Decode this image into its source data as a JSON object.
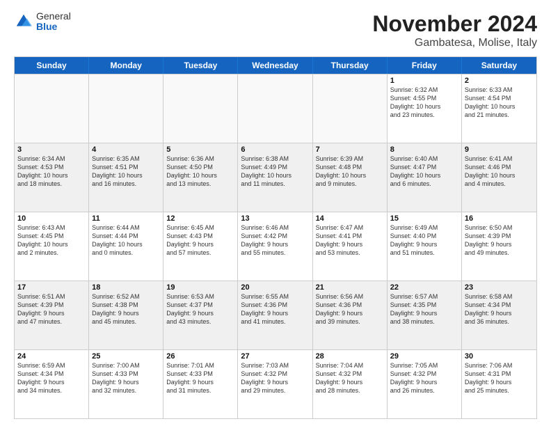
{
  "logo": {
    "general": "General",
    "blue": "Blue"
  },
  "title": "November 2024",
  "subtitle": "Gambatesa, Molise, Italy",
  "days": [
    "Sunday",
    "Monday",
    "Tuesday",
    "Wednesday",
    "Thursday",
    "Friday",
    "Saturday"
  ],
  "rows": [
    [
      {
        "day": "",
        "info": ""
      },
      {
        "day": "",
        "info": ""
      },
      {
        "day": "",
        "info": ""
      },
      {
        "day": "",
        "info": ""
      },
      {
        "day": "",
        "info": ""
      },
      {
        "day": "1",
        "info": "Sunrise: 6:32 AM\nSunset: 4:55 PM\nDaylight: 10 hours\nand 23 minutes."
      },
      {
        "day": "2",
        "info": "Sunrise: 6:33 AM\nSunset: 4:54 PM\nDaylight: 10 hours\nand 21 minutes."
      }
    ],
    [
      {
        "day": "3",
        "info": "Sunrise: 6:34 AM\nSunset: 4:53 PM\nDaylight: 10 hours\nand 18 minutes."
      },
      {
        "day": "4",
        "info": "Sunrise: 6:35 AM\nSunset: 4:51 PM\nDaylight: 10 hours\nand 16 minutes."
      },
      {
        "day": "5",
        "info": "Sunrise: 6:36 AM\nSunset: 4:50 PM\nDaylight: 10 hours\nand 13 minutes."
      },
      {
        "day": "6",
        "info": "Sunrise: 6:38 AM\nSunset: 4:49 PM\nDaylight: 10 hours\nand 11 minutes."
      },
      {
        "day": "7",
        "info": "Sunrise: 6:39 AM\nSunset: 4:48 PM\nDaylight: 10 hours\nand 9 minutes."
      },
      {
        "day": "8",
        "info": "Sunrise: 6:40 AM\nSunset: 4:47 PM\nDaylight: 10 hours\nand 6 minutes."
      },
      {
        "day": "9",
        "info": "Sunrise: 6:41 AM\nSunset: 4:46 PM\nDaylight: 10 hours\nand 4 minutes."
      }
    ],
    [
      {
        "day": "10",
        "info": "Sunrise: 6:43 AM\nSunset: 4:45 PM\nDaylight: 10 hours\nand 2 minutes."
      },
      {
        "day": "11",
        "info": "Sunrise: 6:44 AM\nSunset: 4:44 PM\nDaylight: 10 hours\nand 0 minutes."
      },
      {
        "day": "12",
        "info": "Sunrise: 6:45 AM\nSunset: 4:43 PM\nDaylight: 9 hours\nand 57 minutes."
      },
      {
        "day": "13",
        "info": "Sunrise: 6:46 AM\nSunset: 4:42 PM\nDaylight: 9 hours\nand 55 minutes."
      },
      {
        "day": "14",
        "info": "Sunrise: 6:47 AM\nSunset: 4:41 PM\nDaylight: 9 hours\nand 53 minutes."
      },
      {
        "day": "15",
        "info": "Sunrise: 6:49 AM\nSunset: 4:40 PM\nDaylight: 9 hours\nand 51 minutes."
      },
      {
        "day": "16",
        "info": "Sunrise: 6:50 AM\nSunset: 4:39 PM\nDaylight: 9 hours\nand 49 minutes."
      }
    ],
    [
      {
        "day": "17",
        "info": "Sunrise: 6:51 AM\nSunset: 4:39 PM\nDaylight: 9 hours\nand 47 minutes."
      },
      {
        "day": "18",
        "info": "Sunrise: 6:52 AM\nSunset: 4:38 PM\nDaylight: 9 hours\nand 45 minutes."
      },
      {
        "day": "19",
        "info": "Sunrise: 6:53 AM\nSunset: 4:37 PM\nDaylight: 9 hours\nand 43 minutes."
      },
      {
        "day": "20",
        "info": "Sunrise: 6:55 AM\nSunset: 4:36 PM\nDaylight: 9 hours\nand 41 minutes."
      },
      {
        "day": "21",
        "info": "Sunrise: 6:56 AM\nSunset: 4:36 PM\nDaylight: 9 hours\nand 39 minutes."
      },
      {
        "day": "22",
        "info": "Sunrise: 6:57 AM\nSunset: 4:35 PM\nDaylight: 9 hours\nand 38 minutes."
      },
      {
        "day": "23",
        "info": "Sunrise: 6:58 AM\nSunset: 4:34 PM\nDaylight: 9 hours\nand 36 minutes."
      }
    ],
    [
      {
        "day": "24",
        "info": "Sunrise: 6:59 AM\nSunset: 4:34 PM\nDaylight: 9 hours\nand 34 minutes."
      },
      {
        "day": "25",
        "info": "Sunrise: 7:00 AM\nSunset: 4:33 PM\nDaylight: 9 hours\nand 32 minutes."
      },
      {
        "day": "26",
        "info": "Sunrise: 7:01 AM\nSunset: 4:33 PM\nDaylight: 9 hours\nand 31 minutes."
      },
      {
        "day": "27",
        "info": "Sunrise: 7:03 AM\nSunset: 4:32 PM\nDaylight: 9 hours\nand 29 minutes."
      },
      {
        "day": "28",
        "info": "Sunrise: 7:04 AM\nSunset: 4:32 PM\nDaylight: 9 hours\nand 28 minutes."
      },
      {
        "day": "29",
        "info": "Sunrise: 7:05 AM\nSunset: 4:32 PM\nDaylight: 9 hours\nand 26 minutes."
      },
      {
        "day": "30",
        "info": "Sunrise: 7:06 AM\nSunset: 4:31 PM\nDaylight: 9 hours\nand 25 minutes."
      }
    ]
  ]
}
